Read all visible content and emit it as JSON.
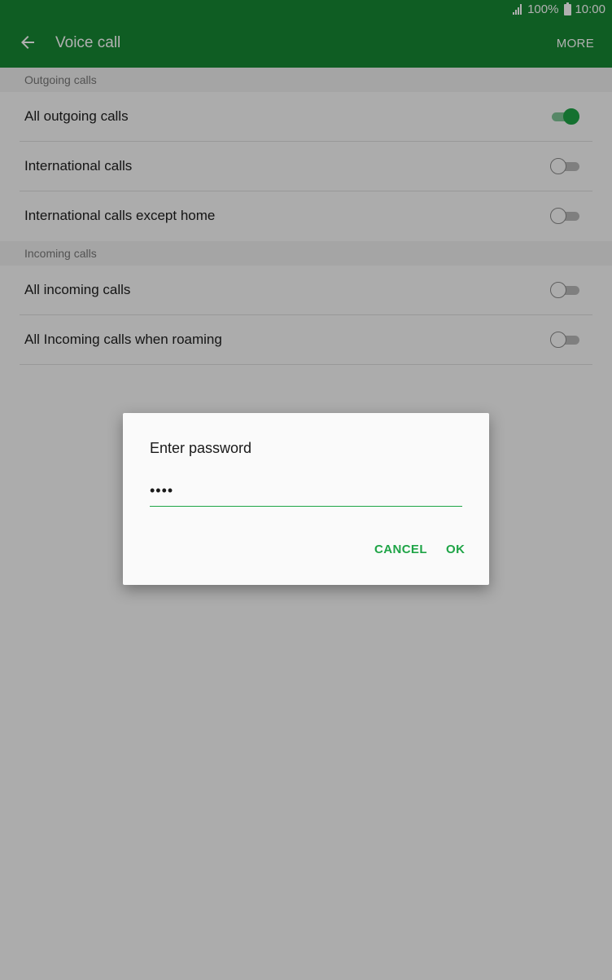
{
  "status_bar": {
    "battery": "100%",
    "time": "10:00"
  },
  "app_bar": {
    "title": "Voice call",
    "more_label": "MORE"
  },
  "outgoing": {
    "header": "Outgoing calls",
    "items": [
      {
        "label": "All outgoing calls",
        "enabled": true
      },
      {
        "label": "International calls",
        "enabled": false
      },
      {
        "label": "International calls except home",
        "enabled": false
      }
    ]
  },
  "incoming": {
    "header": "Incoming calls",
    "items": [
      {
        "label": "All incoming calls",
        "enabled": false
      },
      {
        "label": "All Incoming calls when roaming",
        "enabled": false
      }
    ]
  },
  "dialog": {
    "title": "Enter password",
    "password_value": "••••",
    "cancel_label": "CANCEL",
    "ok_label": "OK"
  },
  "colors": {
    "primary": "#178733",
    "accent": "#1ea446",
    "scrim": "#000000"
  },
  "icons": {
    "back": "arrow-left-icon",
    "signal": "signal-icon",
    "battery": "battery-icon"
  }
}
